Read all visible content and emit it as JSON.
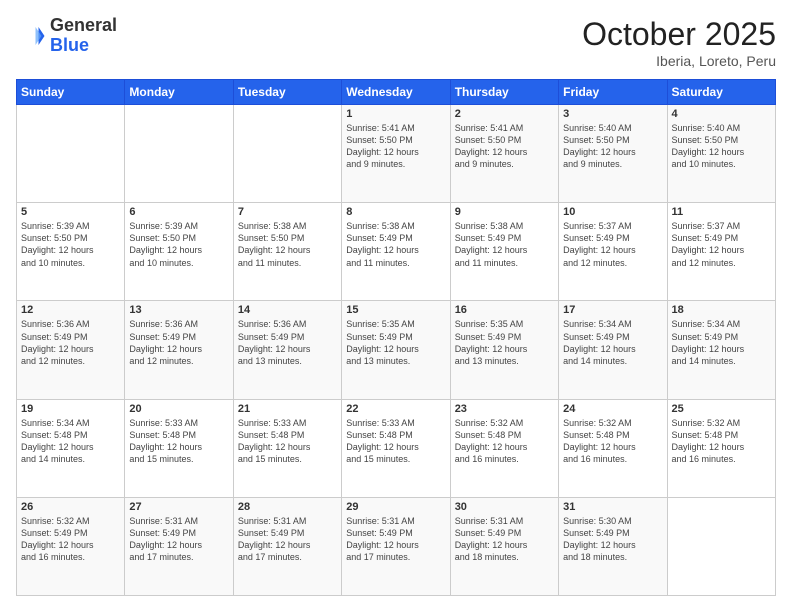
{
  "header": {
    "logo_general": "General",
    "logo_blue": "Blue",
    "month": "October 2025",
    "location": "Iberia, Loreto, Peru"
  },
  "calendar": {
    "days_of_week": [
      "Sunday",
      "Monday",
      "Tuesday",
      "Wednesday",
      "Thursday",
      "Friday",
      "Saturday"
    ],
    "weeks": [
      [
        {
          "day": "",
          "content": ""
        },
        {
          "day": "",
          "content": ""
        },
        {
          "day": "",
          "content": ""
        },
        {
          "day": "1",
          "content": "Sunrise: 5:41 AM\nSunset: 5:50 PM\nDaylight: 12 hours\nand 9 minutes."
        },
        {
          "day": "2",
          "content": "Sunrise: 5:41 AM\nSunset: 5:50 PM\nDaylight: 12 hours\nand 9 minutes."
        },
        {
          "day": "3",
          "content": "Sunrise: 5:40 AM\nSunset: 5:50 PM\nDaylight: 12 hours\nand 9 minutes."
        },
        {
          "day": "4",
          "content": "Sunrise: 5:40 AM\nSunset: 5:50 PM\nDaylight: 12 hours\nand 10 minutes."
        }
      ],
      [
        {
          "day": "5",
          "content": "Sunrise: 5:39 AM\nSunset: 5:50 PM\nDaylight: 12 hours\nand 10 minutes."
        },
        {
          "day": "6",
          "content": "Sunrise: 5:39 AM\nSunset: 5:50 PM\nDaylight: 12 hours\nand 10 minutes."
        },
        {
          "day": "7",
          "content": "Sunrise: 5:38 AM\nSunset: 5:50 PM\nDaylight: 12 hours\nand 11 minutes."
        },
        {
          "day": "8",
          "content": "Sunrise: 5:38 AM\nSunset: 5:49 PM\nDaylight: 12 hours\nand 11 minutes."
        },
        {
          "day": "9",
          "content": "Sunrise: 5:38 AM\nSunset: 5:49 PM\nDaylight: 12 hours\nand 11 minutes."
        },
        {
          "day": "10",
          "content": "Sunrise: 5:37 AM\nSunset: 5:49 PM\nDaylight: 12 hours\nand 12 minutes."
        },
        {
          "day": "11",
          "content": "Sunrise: 5:37 AM\nSunset: 5:49 PM\nDaylight: 12 hours\nand 12 minutes."
        }
      ],
      [
        {
          "day": "12",
          "content": "Sunrise: 5:36 AM\nSunset: 5:49 PM\nDaylight: 12 hours\nand 12 minutes."
        },
        {
          "day": "13",
          "content": "Sunrise: 5:36 AM\nSunset: 5:49 PM\nDaylight: 12 hours\nand 12 minutes."
        },
        {
          "day": "14",
          "content": "Sunrise: 5:36 AM\nSunset: 5:49 PM\nDaylight: 12 hours\nand 13 minutes."
        },
        {
          "day": "15",
          "content": "Sunrise: 5:35 AM\nSunset: 5:49 PM\nDaylight: 12 hours\nand 13 minutes."
        },
        {
          "day": "16",
          "content": "Sunrise: 5:35 AM\nSunset: 5:49 PM\nDaylight: 12 hours\nand 13 minutes."
        },
        {
          "day": "17",
          "content": "Sunrise: 5:34 AM\nSunset: 5:49 PM\nDaylight: 12 hours\nand 14 minutes."
        },
        {
          "day": "18",
          "content": "Sunrise: 5:34 AM\nSunset: 5:49 PM\nDaylight: 12 hours\nand 14 minutes."
        }
      ],
      [
        {
          "day": "19",
          "content": "Sunrise: 5:34 AM\nSunset: 5:48 PM\nDaylight: 12 hours\nand 14 minutes."
        },
        {
          "day": "20",
          "content": "Sunrise: 5:33 AM\nSunset: 5:48 PM\nDaylight: 12 hours\nand 15 minutes."
        },
        {
          "day": "21",
          "content": "Sunrise: 5:33 AM\nSunset: 5:48 PM\nDaylight: 12 hours\nand 15 minutes."
        },
        {
          "day": "22",
          "content": "Sunrise: 5:33 AM\nSunset: 5:48 PM\nDaylight: 12 hours\nand 15 minutes."
        },
        {
          "day": "23",
          "content": "Sunrise: 5:32 AM\nSunset: 5:48 PM\nDaylight: 12 hours\nand 16 minutes."
        },
        {
          "day": "24",
          "content": "Sunrise: 5:32 AM\nSunset: 5:48 PM\nDaylight: 12 hours\nand 16 minutes."
        },
        {
          "day": "25",
          "content": "Sunrise: 5:32 AM\nSunset: 5:48 PM\nDaylight: 12 hours\nand 16 minutes."
        }
      ],
      [
        {
          "day": "26",
          "content": "Sunrise: 5:32 AM\nSunset: 5:49 PM\nDaylight: 12 hours\nand 16 minutes."
        },
        {
          "day": "27",
          "content": "Sunrise: 5:31 AM\nSunset: 5:49 PM\nDaylight: 12 hours\nand 17 minutes."
        },
        {
          "day": "28",
          "content": "Sunrise: 5:31 AM\nSunset: 5:49 PM\nDaylight: 12 hours\nand 17 minutes."
        },
        {
          "day": "29",
          "content": "Sunrise: 5:31 AM\nSunset: 5:49 PM\nDaylight: 12 hours\nand 17 minutes."
        },
        {
          "day": "30",
          "content": "Sunrise: 5:31 AM\nSunset: 5:49 PM\nDaylight: 12 hours\nand 18 minutes."
        },
        {
          "day": "31",
          "content": "Sunrise: 5:30 AM\nSunset: 5:49 PM\nDaylight: 12 hours\nand 18 minutes."
        },
        {
          "day": "",
          "content": ""
        }
      ]
    ]
  }
}
